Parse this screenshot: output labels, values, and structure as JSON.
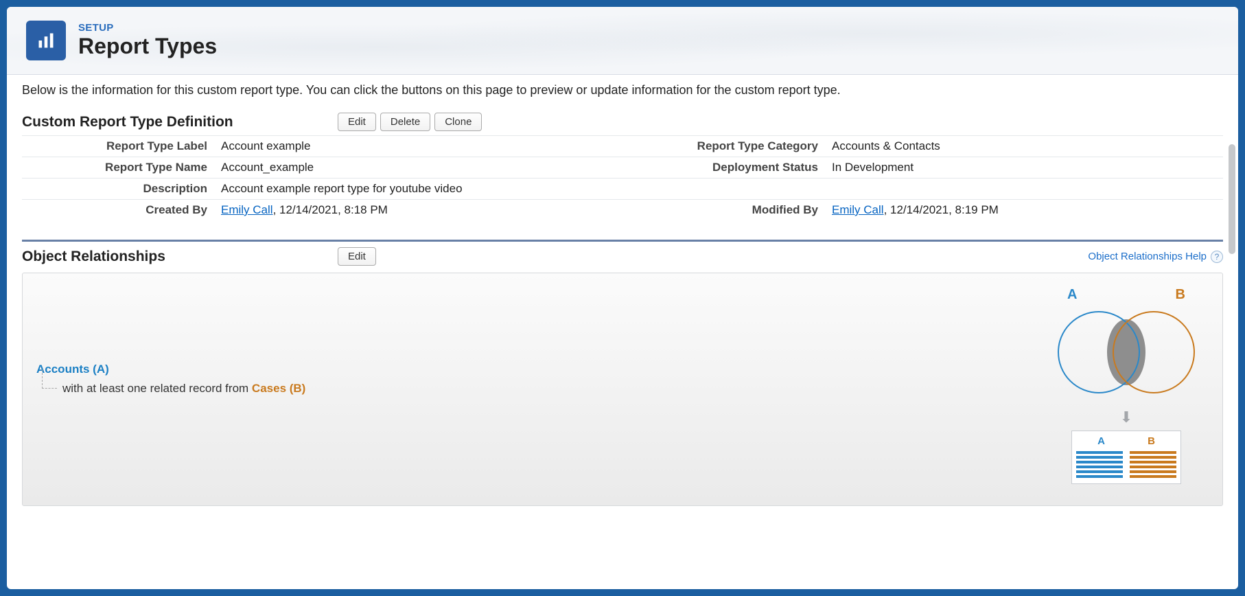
{
  "header": {
    "setup_label": "SETUP",
    "title": "Report Types"
  },
  "intro": "Below is the information for this custom report type. You can click the buttons on this page to preview or update information for the custom report type.",
  "definition": {
    "section_title": "Custom Report Type Definition",
    "buttons": {
      "edit": "Edit",
      "delete": "Delete",
      "clone": "Clone"
    },
    "rows": {
      "label_label": "Report Type Label",
      "label_value": "Account example",
      "category_label": "Report Type Category",
      "category_value": "Accounts & Contacts",
      "name_label": "Report Type Name",
      "name_value": "Account_example",
      "deploy_label": "Deployment Status",
      "deploy_value": "In Development",
      "desc_label": "Description",
      "desc_value": "Account example report type for youtube video",
      "created_label": "Created By",
      "created_user": "Emily Call",
      "created_meta": ", 12/14/2021, 8:18 PM",
      "modified_label": "Modified By",
      "modified_user": "Emily Call",
      "modified_meta": ", 12/14/2021, 8:19 PM"
    }
  },
  "relationships": {
    "section_title": "Object Relationships",
    "edit_btn": "Edit",
    "help_text": "Object Relationships Help",
    "primary": "Accounts (A)",
    "child_prefix": "with at least one related record from ",
    "child_obj": "Cases (B)",
    "venn": {
      "a": "A",
      "b": "B"
    }
  }
}
